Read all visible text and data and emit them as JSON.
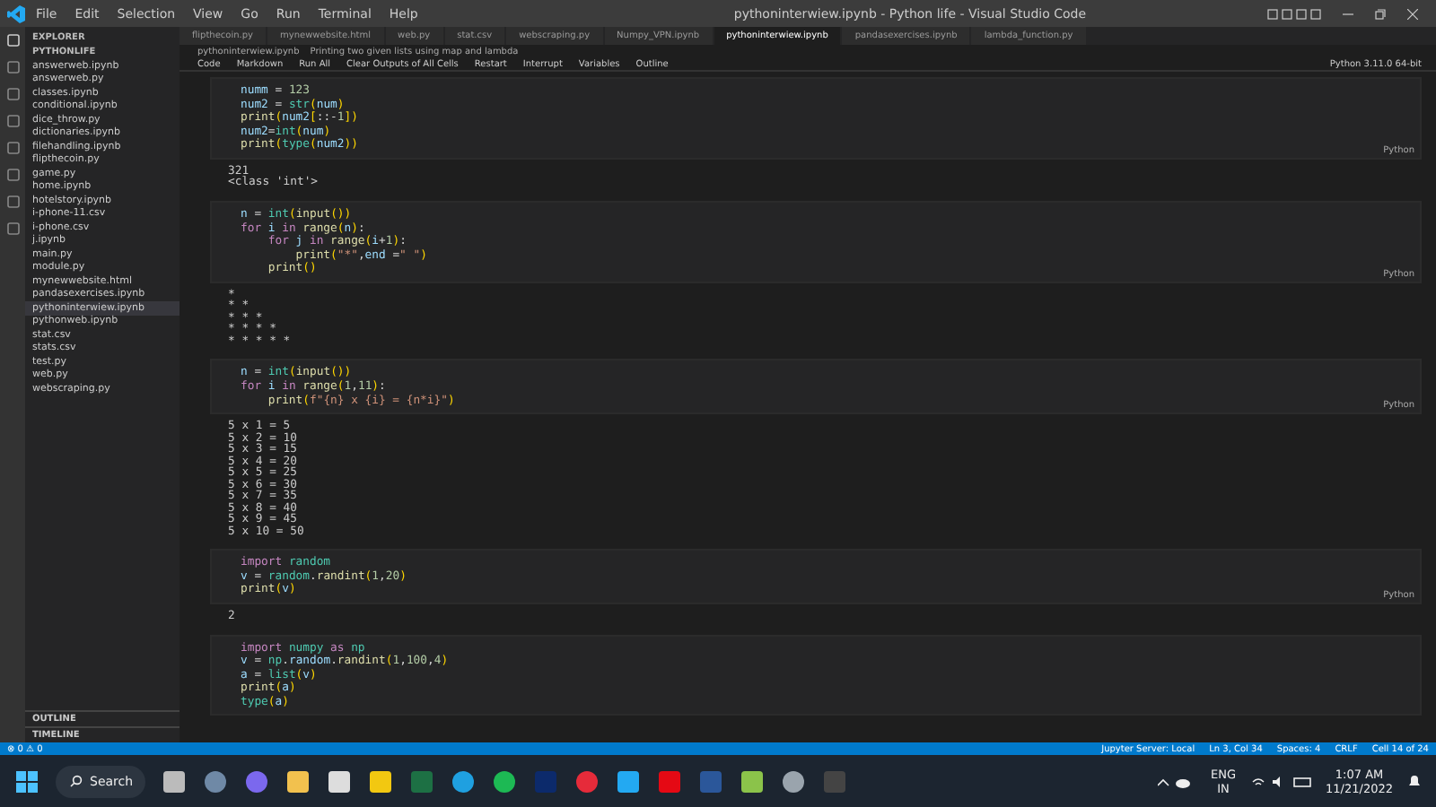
{
  "window": {
    "title": "pythoninterwiew.ipynb - Python life - Visual Studio Code"
  },
  "menu": [
    "File",
    "Edit",
    "Selection",
    "View",
    "Go",
    "Run",
    "Terminal",
    "Help"
  ],
  "sidebar": {
    "title": "EXPLORER",
    "folder": "PYTHONLIFE",
    "items": [
      {
        "name": "answerweb.ipynb",
        "selected": false
      },
      {
        "name": "answerweb.py",
        "selected": false
      },
      {
        "name": "classes.ipynb",
        "selected": false
      },
      {
        "name": "conditional.ipynb",
        "selected": false
      },
      {
        "name": "dice_throw.py",
        "selected": false
      },
      {
        "name": "dictionaries.ipynb",
        "selected": false
      },
      {
        "name": "filehandling.ipynb",
        "selected": false
      },
      {
        "name": "flipthecoin.py",
        "selected": false
      },
      {
        "name": "game.py",
        "selected": false
      },
      {
        "name": "home.ipynb",
        "selected": false
      },
      {
        "name": "hotelstory.ipynb",
        "selected": false
      },
      {
        "name": "i-phone-11.csv",
        "selected": false
      },
      {
        "name": "i-phone.csv",
        "selected": false
      },
      {
        "name": "j.ipynb",
        "selected": false
      },
      {
        "name": "main.py",
        "selected": false
      },
      {
        "name": "module.py",
        "selected": false
      },
      {
        "name": "mynewwebsite.html",
        "selected": false
      },
      {
        "name": "pandasexercises.ipynb",
        "selected": false
      },
      {
        "name": "pythoninterwiew.ipynb",
        "selected": true
      },
      {
        "name": "pythonweb.ipynb",
        "selected": false
      },
      {
        "name": "stat.csv",
        "selected": false
      },
      {
        "name": "stats.csv",
        "selected": false
      },
      {
        "name": "test.py",
        "selected": false
      },
      {
        "name": "web.py",
        "selected": false
      },
      {
        "name": "webscraping.py",
        "selected": false
      }
    ],
    "sections": [
      "OUTLINE",
      "TIMELINE"
    ]
  },
  "tabs": [
    {
      "label": "flipthecoin.py",
      "selected": false
    },
    {
      "label": "mynewwebsite.html",
      "selected": false
    },
    {
      "label": "web.py",
      "selected": false
    },
    {
      "label": "stat.csv",
      "selected": false
    },
    {
      "label": "webscraping.py",
      "selected": false
    },
    {
      "label": "Numpy_VPN.ipynb",
      "selected": false
    },
    {
      "label": "pythoninterwiew.ipynb",
      "selected": true
    },
    {
      "label": "pandasexercises.ipynb",
      "selected": false
    },
    {
      "label": "lambda_function.py",
      "selected": false
    }
  ],
  "breadcrumb": [
    "pythoninterwiew.ipynb",
    "Printing two given lists using map and lambda"
  ],
  "toolbar": [
    "Code",
    "Markdown",
    "Run All",
    "Clear Outputs of All Cells",
    "Restart",
    "Interrupt",
    "Variables",
    "Outline"
  ],
  "kernel": "Python 3.11.0 64-bit",
  "cells": [
    {
      "language": "Python",
      "lines": [
        [
          {
            "kind": "var",
            "text": "numm"
          },
          {
            "kind": "op",
            "text": " = "
          },
          {
            "kind": "num",
            "text": "123"
          }
        ],
        [
          {
            "kind": "var",
            "text": "num2"
          },
          {
            "kind": "op",
            "text": " = "
          },
          {
            "kind": "cls",
            "text": "str"
          },
          {
            "kind": "par",
            "text": "("
          },
          {
            "kind": "var",
            "text": "num"
          },
          {
            "kind": "par",
            "text": ")"
          }
        ],
        [
          {
            "kind": "fn",
            "text": "print"
          },
          {
            "kind": "par",
            "text": "("
          },
          {
            "kind": "var",
            "text": "num2"
          },
          {
            "kind": "par",
            "text": "["
          },
          {
            "kind": "op",
            "text": "::-"
          },
          {
            "kind": "num",
            "text": "1"
          },
          {
            "kind": "par",
            "text": "])"
          }
        ],
        [
          {
            "kind": "var",
            "text": "num2"
          },
          {
            "kind": "op",
            "text": "="
          },
          {
            "kind": "cls",
            "text": "int"
          },
          {
            "kind": "par",
            "text": "("
          },
          {
            "kind": "var",
            "text": "num"
          },
          {
            "kind": "par",
            "text": ")"
          }
        ],
        [
          {
            "kind": "fn",
            "text": "print"
          },
          {
            "kind": "par",
            "text": "("
          },
          {
            "kind": "cls",
            "text": "type"
          },
          {
            "kind": "par",
            "text": "("
          },
          {
            "kind": "var",
            "text": "num2"
          },
          {
            "kind": "par",
            "text": "))"
          }
        ]
      ],
      "output": "321\n<class 'int'>"
    },
    {
      "language": "Python",
      "lines": [
        [
          {
            "kind": "var",
            "text": "n"
          },
          {
            "kind": "op",
            "text": " = "
          },
          {
            "kind": "cls",
            "text": "int"
          },
          {
            "kind": "par",
            "text": "("
          },
          {
            "kind": "fn",
            "text": "input"
          },
          {
            "kind": "par",
            "text": "())"
          }
        ],
        [
          {
            "kind": "kw",
            "text": "for "
          },
          {
            "kind": "var",
            "text": "i"
          },
          {
            "kind": "kw",
            "text": " in "
          },
          {
            "kind": "fn",
            "text": "range"
          },
          {
            "kind": "par",
            "text": "("
          },
          {
            "kind": "var",
            "text": "n"
          },
          {
            "kind": "par",
            "text": ")"
          },
          {
            "kind": "op",
            "text": ":"
          }
        ],
        [
          {
            "kind": "kw",
            "text": "    for "
          },
          {
            "kind": "var",
            "text": "j"
          },
          {
            "kind": "kw",
            "text": " in "
          },
          {
            "kind": "fn",
            "text": "range"
          },
          {
            "kind": "par",
            "text": "("
          },
          {
            "kind": "var",
            "text": "i"
          },
          {
            "kind": "op",
            "text": "+"
          },
          {
            "kind": "num",
            "text": "1"
          },
          {
            "kind": "par",
            "text": ")"
          },
          {
            "kind": "op",
            "text": ":"
          }
        ],
        [
          {
            "kind": "fn",
            "text": "        print"
          },
          {
            "kind": "par",
            "text": "("
          },
          {
            "kind": "str",
            "text": "\"*\""
          },
          {
            "kind": "op",
            "text": ","
          },
          {
            "kind": "var",
            "text": "end"
          },
          {
            "kind": "op",
            "text": " ="
          },
          {
            "kind": "str",
            "text": "\" \""
          },
          {
            "kind": "par",
            "text": ")"
          }
        ],
        [
          {
            "kind": "fn",
            "text": "    print"
          },
          {
            "kind": "par",
            "text": "()"
          }
        ]
      ],
      "output": "*\n* *\n* * *\n* * * *\n* * * * *"
    },
    {
      "language": "Python",
      "lines": [
        [
          {
            "kind": "var",
            "text": "n"
          },
          {
            "kind": "op",
            "text": " = "
          },
          {
            "kind": "cls",
            "text": "int"
          },
          {
            "kind": "par",
            "text": "("
          },
          {
            "kind": "fn",
            "text": "input"
          },
          {
            "kind": "par",
            "text": "())"
          }
        ],
        [
          {
            "kind": "kw",
            "text": "for "
          },
          {
            "kind": "var",
            "text": "i"
          },
          {
            "kind": "kw",
            "text": " in "
          },
          {
            "kind": "fn",
            "text": "range"
          },
          {
            "kind": "par",
            "text": "("
          },
          {
            "kind": "num",
            "text": "1"
          },
          {
            "kind": "op",
            "text": ","
          },
          {
            "kind": "num",
            "text": "11"
          },
          {
            "kind": "par",
            "text": ")"
          },
          {
            "kind": "op",
            "text": ":"
          }
        ],
        [
          {
            "kind": "fn",
            "text": "    print"
          },
          {
            "kind": "par",
            "text": "("
          },
          {
            "kind": "str",
            "text": "f\"{n} x {i} = {n*i}\""
          },
          {
            "kind": "par",
            "text": ")"
          }
        ]
      ],
      "output": "5 x 1 = 5\n5 x 2 = 10\n5 x 3 = 15\n5 x 4 = 20\n5 x 5 = 25\n5 x 6 = 30\n5 x 7 = 35\n5 x 8 = 40\n5 x 9 = 45\n5 x 10 = 50"
    },
    {
      "language": "Python",
      "lines": [
        [
          {
            "kind": "kw",
            "text": "import "
          },
          {
            "kind": "cls",
            "text": "random"
          }
        ],
        [
          {
            "kind": "var",
            "text": "v"
          },
          {
            "kind": "op",
            "text": " = "
          },
          {
            "kind": "cls",
            "text": "random"
          },
          {
            "kind": "op",
            "text": "."
          },
          {
            "kind": "fn",
            "text": "randint"
          },
          {
            "kind": "par",
            "text": "("
          },
          {
            "kind": "num",
            "text": "1"
          },
          {
            "kind": "op",
            "text": ","
          },
          {
            "kind": "num",
            "text": "20"
          },
          {
            "kind": "par",
            "text": ")"
          }
        ],
        [
          {
            "kind": "fn",
            "text": "print"
          },
          {
            "kind": "par",
            "text": "("
          },
          {
            "kind": "var",
            "text": "v"
          },
          {
            "kind": "par",
            "text": ")"
          }
        ]
      ],
      "output": "2"
    },
    {
      "lines": [
        [
          {
            "kind": "kw",
            "text": "import "
          },
          {
            "kind": "cls",
            "text": "numpy"
          },
          {
            "kind": "kw",
            "text": " as "
          },
          {
            "kind": "cls",
            "text": "np"
          }
        ],
        [
          {
            "kind": "var",
            "text": "v"
          },
          {
            "kind": "op",
            "text": " = "
          },
          {
            "kind": "cls",
            "text": "np"
          },
          {
            "kind": "op",
            "text": "."
          },
          {
            "kind": "var",
            "text": "random"
          },
          {
            "kind": "op",
            "text": "."
          },
          {
            "kind": "fn",
            "text": "randint"
          },
          {
            "kind": "par",
            "text": "("
          },
          {
            "kind": "num",
            "text": "1"
          },
          {
            "kind": "op",
            "text": ","
          },
          {
            "kind": "num",
            "text": "100"
          },
          {
            "kind": "op",
            "text": ","
          },
          {
            "kind": "num",
            "text": "4"
          },
          {
            "kind": "par",
            "text": ")"
          }
        ],
        [
          {
            "kind": "var",
            "text": "a"
          },
          {
            "kind": "op",
            "text": " = "
          },
          {
            "kind": "cls",
            "text": "list"
          },
          {
            "kind": "par",
            "text": "("
          },
          {
            "kind": "var",
            "text": "v"
          },
          {
            "kind": "par",
            "text": ")"
          }
        ],
        [
          {
            "kind": "fn",
            "text": "print"
          },
          {
            "kind": "par",
            "text": "("
          },
          {
            "kind": "var",
            "text": "a"
          },
          {
            "kind": "par",
            "text": ")"
          }
        ],
        [
          {
            "kind": "cls",
            "text": "type"
          },
          {
            "kind": "par",
            "text": "("
          },
          {
            "kind": "var",
            "text": "a"
          },
          {
            "kind": "par",
            "text": ")"
          }
        ]
      ]
    }
  ],
  "status_bar": {
    "left": "⊗ 0  ⚠ 0",
    "right": [
      "Jupyter Server: Local",
      "Ln 3, Col 34",
      "Spaces: 4",
      "CRLF",
      "Cell 14 of 24"
    ]
  },
  "taskbar": {
    "search": "Search",
    "lang": [
      "ENG",
      "IN"
    ],
    "time": "1:07 AM",
    "date": "11/21/2022"
  }
}
